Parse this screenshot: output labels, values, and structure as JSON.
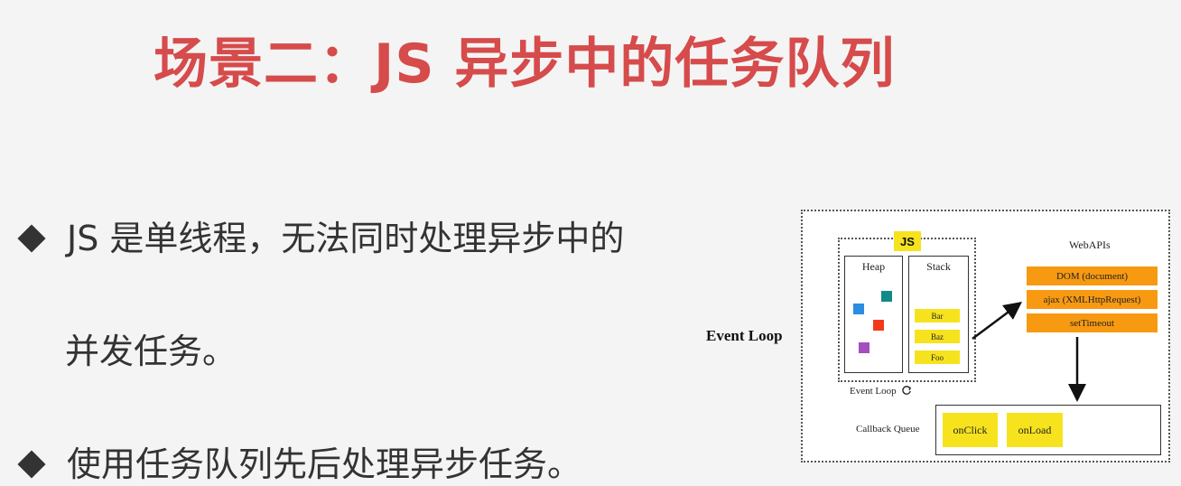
{
  "title": "场景二：JS 异步中的任务队列",
  "bullets": [
    {
      "line1": "JS 是单线程，无法同时处理异步中的",
      "line2": "并发任务。"
    },
    {
      "line1": "使用任务队列先后处理异步任务。"
    }
  ],
  "diagram": {
    "label": "Event Loop",
    "js_badge": "JS",
    "heap": {
      "title": "Heap",
      "object_colors": [
        "#2b8de0",
        "#128a87",
        "#f23a1a",
        "#a24fc2"
      ]
    },
    "stack": {
      "title": "Stack",
      "frames": [
        "Bar",
        "Baz",
        "Foo"
      ]
    },
    "webapis": {
      "title": "WebAPIs",
      "items": [
        "DOM (document)",
        "ajax (XMLHttpRequest)",
        "setTimeout"
      ]
    },
    "event_loop_label": "Event Loop",
    "loop_icon": "refresh-icon",
    "callback_queue": {
      "label": "Callback Queue",
      "items": [
        "onClick",
        "onLoad"
      ]
    },
    "colors": {
      "yellow": "#f6e31e",
      "orange": "#f79a12",
      "title_red": "#d64b4b"
    }
  }
}
